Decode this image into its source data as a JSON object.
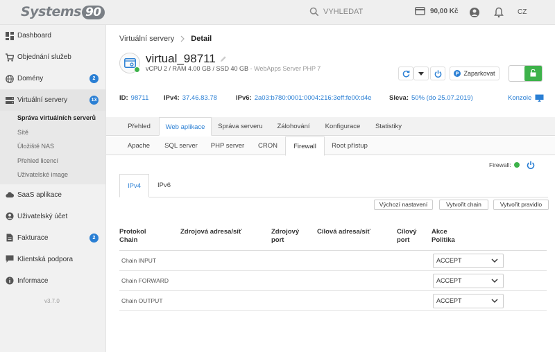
{
  "header": {
    "logo_text": "Systems",
    "logo_num": "90",
    "search_placeholder": "VYHLEDAT",
    "credit": "90,00 Kč",
    "language": "CZ"
  },
  "sidebar": {
    "items": [
      {
        "label": "Dashboard",
        "icon": "dashboard-icon"
      },
      {
        "label": "Objednání služeb",
        "icon": "cart-icon"
      },
      {
        "label": "Domény",
        "icon": "globe-icon",
        "badge": "2"
      },
      {
        "label": "Virtuální servery",
        "icon": "server-icon",
        "badge": "13"
      },
      {
        "label": "SaaS aplikace",
        "icon": "cloud-icon"
      },
      {
        "label": "Uživatelský účet",
        "icon": "user-icon"
      },
      {
        "label": "Fakturace",
        "icon": "invoice-icon",
        "badge": "2"
      },
      {
        "label": "Klientská podpora",
        "icon": "chat-icon"
      },
      {
        "label": "Informace",
        "icon": "info-icon"
      }
    ],
    "subitems": [
      "Správa virtuálních serverů",
      "Sítě",
      "Úložiště NAS",
      "Přehled licencí",
      "Uživatelské image"
    ],
    "version": "v3.7.0"
  },
  "breadcrumb": {
    "parent": "Virtuální servery",
    "current": "Detail"
  },
  "server": {
    "name": "virtual_98711",
    "specs": "vCPU 2 / RAM 4.00 GB / SSD 40 GB",
    "app": "- WebApps Server PHP 7",
    "park_label": "Zaparkovat"
  },
  "info": {
    "id_label": "ID:",
    "id_value": "98711",
    "ipv4_label": "IPv4:",
    "ipv4_value": "37.46.83.78",
    "ipv6_label": "IPv6:",
    "ipv6_value": "2a03:b780:0001:0004:216:3eff:fe00:d4e",
    "discount_label": "Sleva:",
    "discount_value": "50% (do 25.07.2019)",
    "console_label": "Konzole"
  },
  "tabs": [
    "Přehled",
    "Web aplikace",
    "Správa serveru",
    "Zálohování",
    "Konfigurace",
    "Statistiky"
  ],
  "subtabs": [
    "Apache",
    "SQL server",
    "PHP server",
    "CRON",
    "Firewall",
    "Root přístup"
  ],
  "firewall": {
    "status_label": "Firewall:",
    "ip_tabs": [
      "IPv4",
      "IPv6"
    ],
    "buttons": {
      "default": "Výchozí nastavení",
      "create_chain": "Vytvořit chain",
      "create_rule": "Vytvořit pravidlo"
    },
    "columns": [
      {
        "l1": "Protokol",
        "l2": "Chain"
      },
      {
        "l1": "Zdrojová adresa/síť",
        "l2": ""
      },
      {
        "l1": "Zdrojový",
        "l2": "port"
      },
      {
        "l1": "Cílová adresa/síť",
        "l2": ""
      },
      {
        "l1": "Cílový",
        "l2": "port"
      },
      {
        "l1": "Akce",
        "l2": "Politika"
      }
    ],
    "rows": [
      {
        "name": "Chain INPUT",
        "policy": "ACCEPT"
      },
      {
        "name": "Chain FORWARD",
        "policy": "ACCEPT"
      },
      {
        "name": "Chain OUTPUT",
        "policy": "ACCEPT"
      }
    ]
  },
  "colors": {
    "accent": "#2a7fd4",
    "status_green": "#3db24a",
    "sidebar_bg": "#f1f1f1"
  }
}
